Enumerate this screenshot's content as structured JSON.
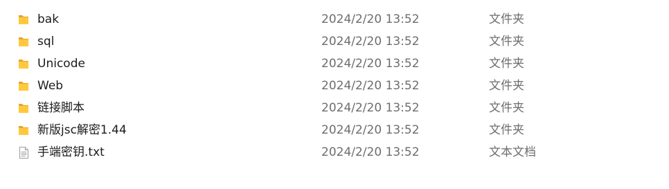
{
  "colors": {
    "folder_body": "#FFC83D",
    "folder_back": "#E8A427",
    "text_primary": "#1B1B1B",
    "text_secondary": "#6D6D6D"
  },
  "files": [
    {
      "name": "bak",
      "modified": "2024/2/20 13:52",
      "type": "文件夹",
      "icon": "folder-icon"
    },
    {
      "name": "sql",
      "modified": "2024/2/20 13:52",
      "type": "文件夹",
      "icon": "folder-icon"
    },
    {
      "name": "Unicode",
      "modified": "2024/2/20 13:52",
      "type": "文件夹",
      "icon": "folder-icon"
    },
    {
      "name": "Web",
      "modified": "2024/2/20 13:52",
      "type": "文件夹",
      "icon": "folder-icon"
    },
    {
      "name": "链接脚本",
      "modified": "2024/2/20 13:52",
      "type": "文件夹",
      "icon": "folder-icon"
    },
    {
      "name": "新版jsc解密1.44",
      "modified": "2024/2/20 13:52",
      "type": "文件夹",
      "icon": "folder-icon"
    },
    {
      "name": "手端密钥.txt",
      "modified": "2024/2/20 13:52",
      "type": "文本文档",
      "icon": "text-file-icon"
    }
  ]
}
